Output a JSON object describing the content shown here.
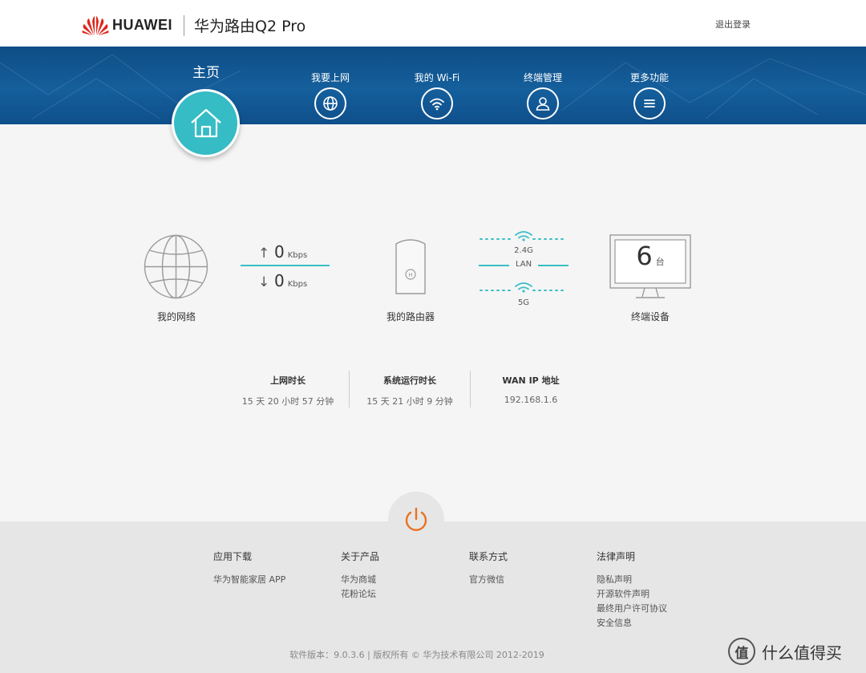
{
  "header": {
    "brand": "HUAWEI",
    "product": "华为路由Q2 Pro",
    "logout": "退出登录"
  },
  "nav": {
    "home": "主页",
    "items": [
      {
        "label": "我要上网",
        "icon": "globe-icon"
      },
      {
        "label": "我的 Wi-Fi",
        "icon": "wifi-icon"
      },
      {
        "label": "终端管理",
        "icon": "user-icon"
      },
      {
        "label": "更多功能",
        "icon": "menu-icon"
      }
    ]
  },
  "status": {
    "network_label": "我的网络",
    "upload_value": "0",
    "upload_unit": "Kbps",
    "download_value": "0",
    "download_unit": "Kbps",
    "router_label": "我的路由器",
    "band_24": "2.4G",
    "lan": "LAN",
    "band_5": "5G",
    "device_count": "6",
    "device_unit": "台",
    "devices_label": "终端设备"
  },
  "stats": [
    {
      "title": "上网时长",
      "value": "15 天 20 小时 57 分钟"
    },
    {
      "title": "系统运行时长",
      "value": "15 天 21 小时 9 分钟"
    },
    {
      "title": "WAN IP 地址",
      "value": "192.168.1.6"
    }
  ],
  "footer": {
    "columns": [
      {
        "title": "应用下载",
        "links": [
          "华为智能家居 APP"
        ]
      },
      {
        "title": "关于产品",
        "links": [
          "华为商城",
          "花粉论坛"
        ]
      },
      {
        "title": "联系方式",
        "links": [
          "官方微信"
        ]
      },
      {
        "title": "法律声明",
        "links": [
          "隐私声明",
          "开源软件声明",
          "最终用户许可协议",
          "安全信息"
        ]
      }
    ],
    "copyright": "软件版本：9.0.3.6  |  版权所有 © 华为技术有限公司 2012-2019"
  },
  "watermark": {
    "badge": "值",
    "text": "什么值得买"
  },
  "colors": {
    "accent": "#35bcc4",
    "nav_blue": "#145f9c",
    "power_orange": "#e8731f"
  }
}
